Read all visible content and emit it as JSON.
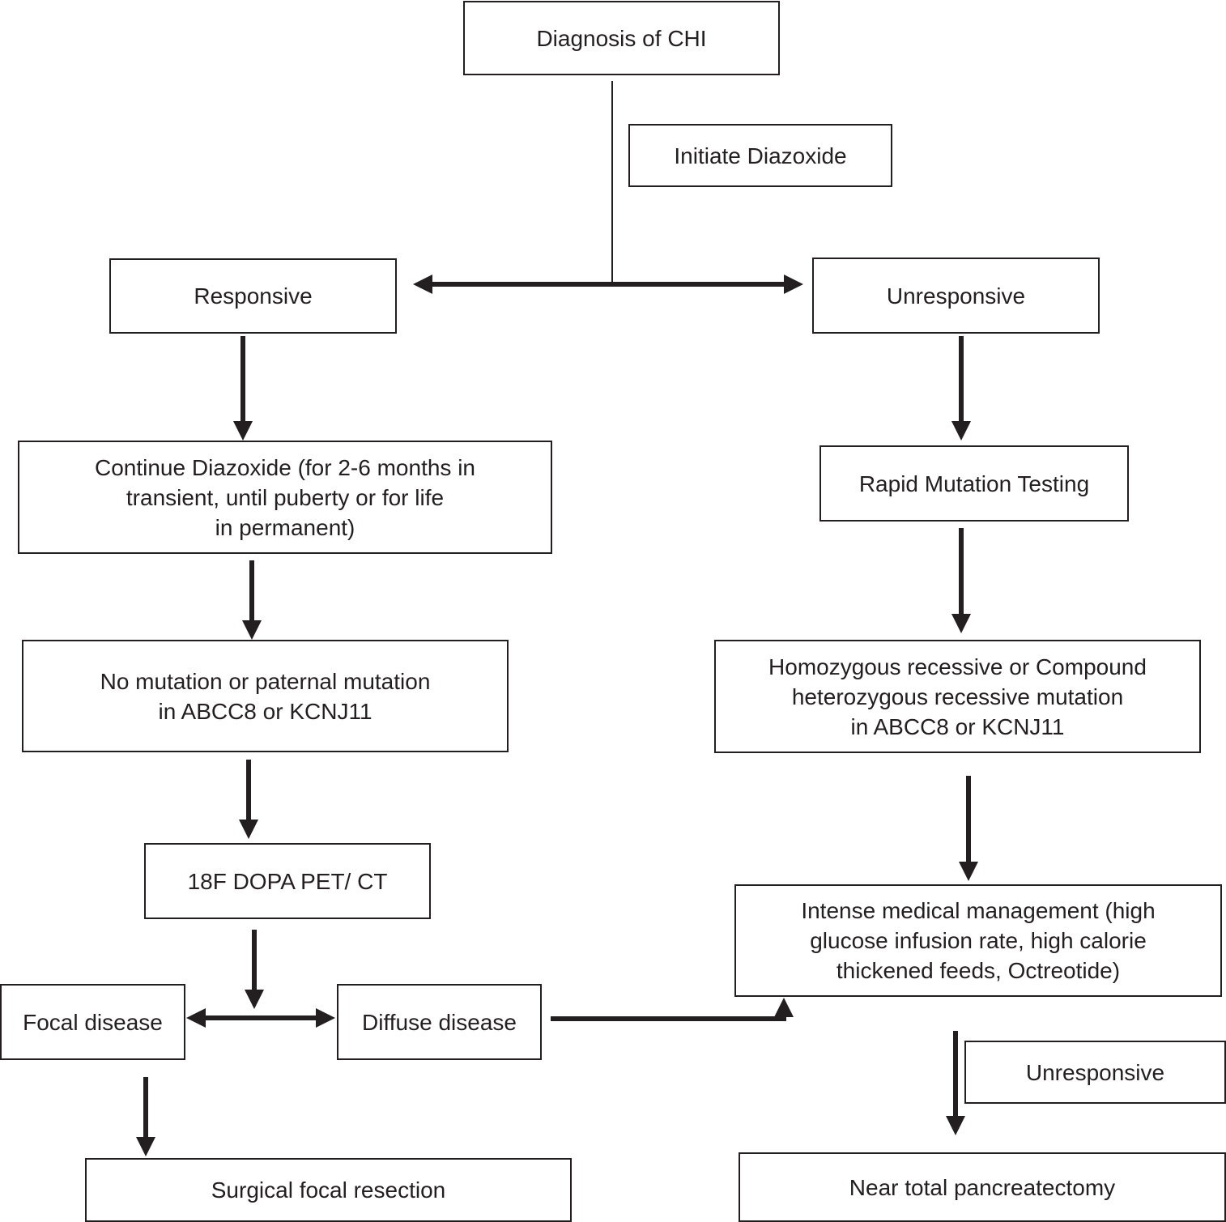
{
  "diagram": {
    "type": "flowchart",
    "nodes": {
      "diagnosis": "Diagnosis of CHI",
      "initiate": "Initiate Diazoxide",
      "responsive": "Responsive",
      "unresponsive": "Unresponsive",
      "continue": "Continue Diazoxide (for 2-6 months in\ntransient, until puberty or for life\nin permanent)",
      "rapid": "Rapid Mutation Testing",
      "no_mutation": "No mutation or paternal mutation\nin ABCC8 or KCNJ11",
      "homozygous": "Homozygous recessive or Compound\nheterozygous recessive mutation\nin ABCC8 or KCNJ11",
      "pet": "18F DOPA PET/ CT",
      "intense": "Intense medical management (high\nglucose infusion rate, high calorie\nthickened feeds, Octreotide)",
      "focal": "Focal disease",
      "diffuse": "Diffuse disease",
      "unresponsive2": "Unresponsive",
      "resection": "Surgical focal resection",
      "pancreatectomy": "Near total pancreatectomy"
    },
    "edges": [
      {
        "from": "diagnosis",
        "to": "responsive",
        "label": "Initiate Diazoxide"
      },
      {
        "from": "diagnosis",
        "to": "unresponsive",
        "label": "Initiate Diazoxide"
      },
      {
        "from": "responsive",
        "to": "continue"
      },
      {
        "from": "continue",
        "to": "no_mutation"
      },
      {
        "from": "no_mutation",
        "to": "pet"
      },
      {
        "from": "pet",
        "to": "focal"
      },
      {
        "from": "pet",
        "to": "diffuse"
      },
      {
        "from": "focal",
        "to": "resection"
      },
      {
        "from": "diffuse",
        "to": "intense"
      },
      {
        "from": "unresponsive",
        "to": "rapid"
      },
      {
        "from": "rapid",
        "to": "homozygous"
      },
      {
        "from": "homozygous",
        "to": "intense"
      },
      {
        "from": "intense",
        "to": "pancreatectomy",
        "label": "Unresponsive"
      }
    ],
    "colors": {
      "stroke": "#231f20",
      "background": "#ffffff"
    }
  }
}
